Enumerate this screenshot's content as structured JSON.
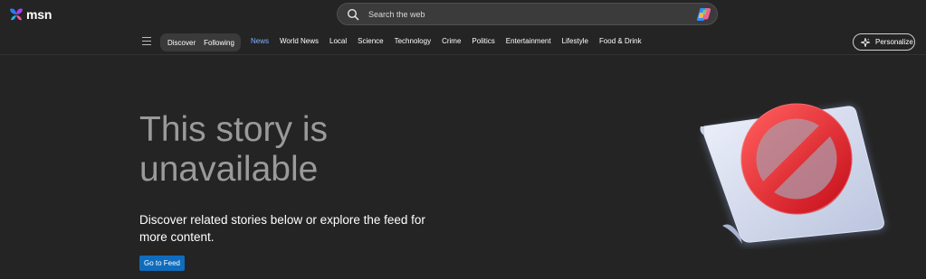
{
  "header": {
    "logo_text": "msn",
    "search": {
      "placeholder": "Search the web",
      "icon": "search-icon",
      "assistant_icon": "copilot-icon"
    }
  },
  "nav": {
    "menu_icon": "hamburger-icon",
    "pill": [
      "Discover",
      "Following"
    ],
    "links": [
      {
        "label": "News",
        "active": true
      },
      {
        "label": "World News",
        "active": false
      },
      {
        "label": "Local",
        "active": false
      },
      {
        "label": "Science",
        "active": false
      },
      {
        "label": "Technology",
        "active": false
      },
      {
        "label": "Crime",
        "active": false
      },
      {
        "label": "Politics",
        "active": false
      },
      {
        "label": "Entertainment",
        "active": false
      },
      {
        "label": "Lifestyle",
        "active": false
      },
      {
        "label": "Food & Drink",
        "active": false
      }
    ],
    "personalize": {
      "label": "Personalize",
      "icon": "personalize-sparkle-icon"
    }
  },
  "main": {
    "headline": "This story is unavailable",
    "subtext": "Discover related stories below or explore the feed for more content.",
    "button_label": "Go to Feed",
    "illustration": "prohibited-sign-on-paper"
  },
  "colors": {
    "background": "#242424",
    "active_nav": "#82b1ff",
    "button": "#0f6cbd",
    "headline": "#9a9a9a",
    "prohibited_red": "#e8232d"
  }
}
